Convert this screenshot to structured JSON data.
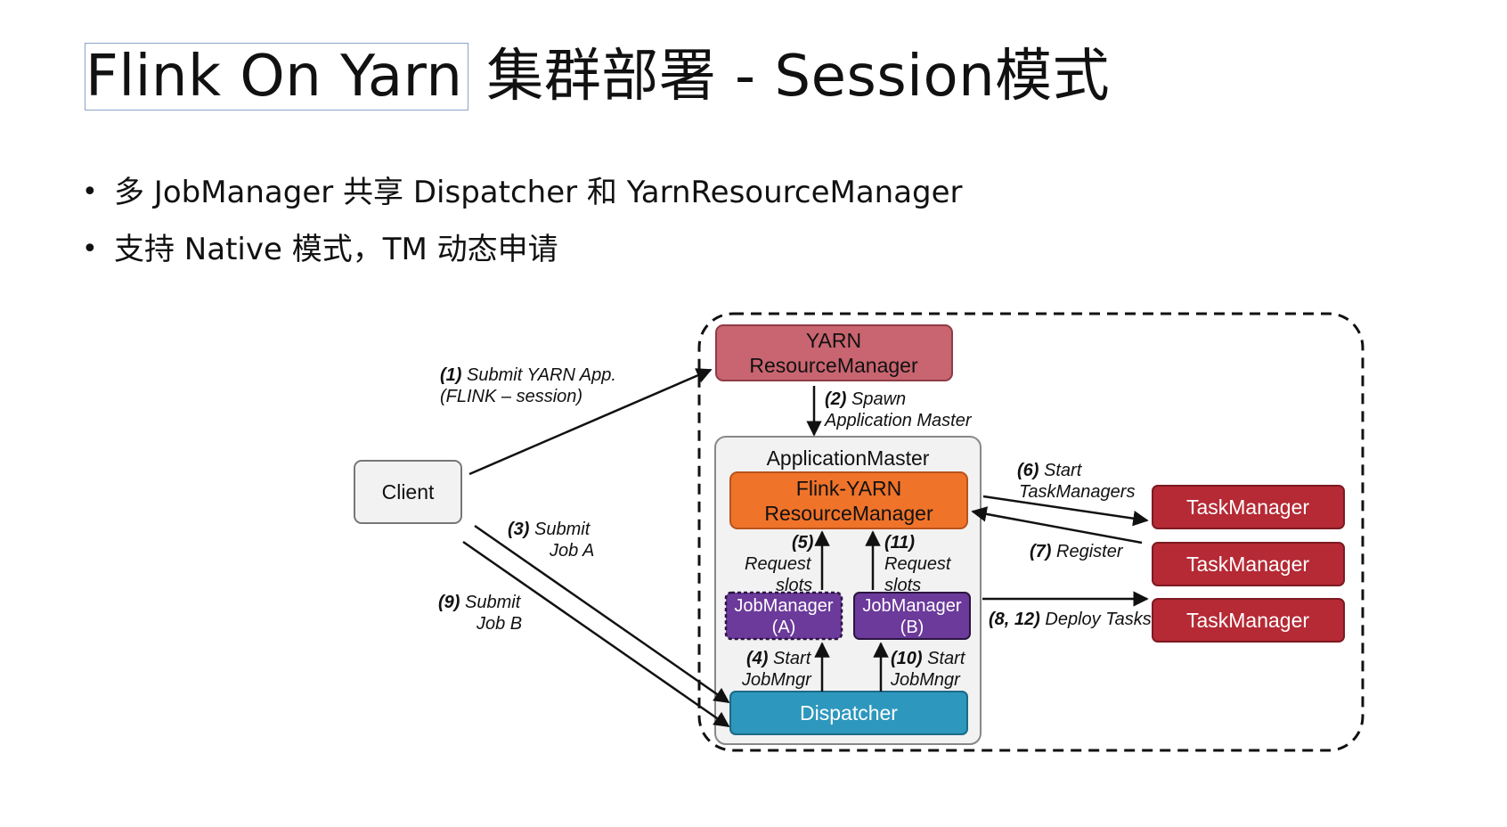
{
  "title": {
    "left": "Flink On Yarn",
    "right": "集群部署 - Session模式"
  },
  "bullets": [
    "多 JobManager 共享 Dispatcher 和 YarnResourceManager",
    "支持 Native 模式，TM 动态申请"
  ],
  "diagram": {
    "client": "Client",
    "yarn_rm": [
      "YARN",
      "ResourceManager"
    ],
    "app_master": "ApplicationMaster",
    "flink_rm": [
      "Flink-YARN",
      "ResourceManager"
    ],
    "jm_a": [
      "JobManager",
      "(A)"
    ],
    "jm_b": [
      "JobManager",
      "(B)"
    ],
    "dispatcher": "Dispatcher",
    "taskmanagers": [
      "TaskManager",
      "TaskManager",
      "TaskManager"
    ],
    "steps": {
      "s1_num": "(1)",
      "s1_text": "Submit YARN App.",
      "s1_line2": "(FLINK – session)",
      "s2_num": "(2)",
      "s2_text": "Spawn",
      "s2_line2": "Application Master",
      "s3_num": "(3)",
      "s3_text": "Submit",
      "s3_line2": "Job A",
      "s4_num": "(4)",
      "s4_text": "Start",
      "s4_line2": "JobMngr",
      "s5_num": "(5)",
      "s5_line2": "Request",
      "s5_line3": "slots",
      "s6_num": "(6)",
      "s6_text": "Start",
      "s6_line2": "TaskManagers",
      "s7_num": "(7)",
      "s7_text": "Register",
      "s8_num": "(8, 12)",
      "s8_text": "Deploy Tasks",
      "s9_num": "(9)",
      "s9_text": "Submit",
      "s9_line2": "Job B",
      "s10_num": "(10)",
      "s10_text": "Start",
      "s10_line2": "JobMngr",
      "s11_num": "(11)",
      "s11_line2": "Request",
      "s11_line3": "slots"
    }
  },
  "colors": {
    "yarn_rm": "#c96570",
    "flink_rm": "#f0732a",
    "jobmanager": "#6b3a9b",
    "dispatcher": "#2e97bd",
    "taskmanager": "#b52a35",
    "client": "#f2f2f2",
    "app_master": "#f2f2f2"
  }
}
